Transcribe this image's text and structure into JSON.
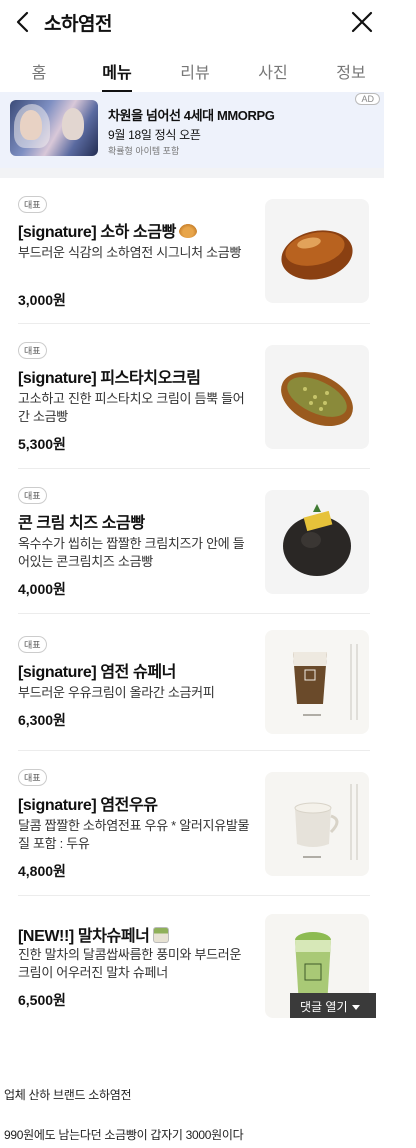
{
  "header": {
    "title": "소하염전",
    "back_icon": "chevron-left-icon",
    "close_icon": "close-icon"
  },
  "tabs": [
    {
      "label": "홈",
      "active": false
    },
    {
      "label": "메뉴",
      "active": true
    },
    {
      "label": "리뷰",
      "active": false
    },
    {
      "label": "사진",
      "active": false
    },
    {
      "label": "정보",
      "active": false
    }
  ],
  "ad": {
    "title": "차원을 넘어선 4세대 MMORPG",
    "subtitle": "9월 18일 정식 오픈",
    "note": "확률형 아이템 포함",
    "badge": "AD"
  },
  "menu": [
    {
      "badge": "대표",
      "name": "[signature] 소하 소금빵",
      "emoji": "croissant",
      "desc": "부드러운 식감의 소하염전 시그니처 소금빵",
      "price": "3,000원"
    },
    {
      "badge": "대표",
      "name": "[signature] 피스타치오크림",
      "desc": "고소하고 진한 피스타치오 크림이 듬뿍 들어간 소금빵",
      "price": "5,300원"
    },
    {
      "badge": "대표",
      "name": "콘 크림 치즈 소금빵",
      "desc": "옥수수가 씹히는 짭짤한 크림치즈가 안에 들어있는 콘크림치즈 소금빵",
      "price": "4,000원"
    },
    {
      "badge": "대표",
      "name": "[signature] 염전 슈페너",
      "desc": "부드러운 우유크림이 올라간 소금커피",
      "price": "6,300원"
    },
    {
      "badge": "대표",
      "name": "[signature] 염전우유",
      "desc": "달콤 짭짤한 소하염전표 우유 * 알러지유발물질 포함 : 두유",
      "price": "4,800원"
    },
    {
      "badge": "",
      "name": "[NEW!!] 말차슈페너",
      "emoji": "matcha",
      "desc": "진한 말차의 달콤쌉싸름한 풍미와 부드러운 크림이 어우러진 말차 슈페너",
      "price": "6,500원"
    }
  ],
  "comment_button": {
    "label": "댓글 열기"
  },
  "comments": [
    "업체 산하 브랜드 소하염전",
    "990원에도 남는다던 소금빵이 갑자기 3000원이다"
  ],
  "colors": {
    "ad_bg": "#eef2fb",
    "divider": "#ececec",
    "comment_button_bg": "#3a3a3a"
  }
}
